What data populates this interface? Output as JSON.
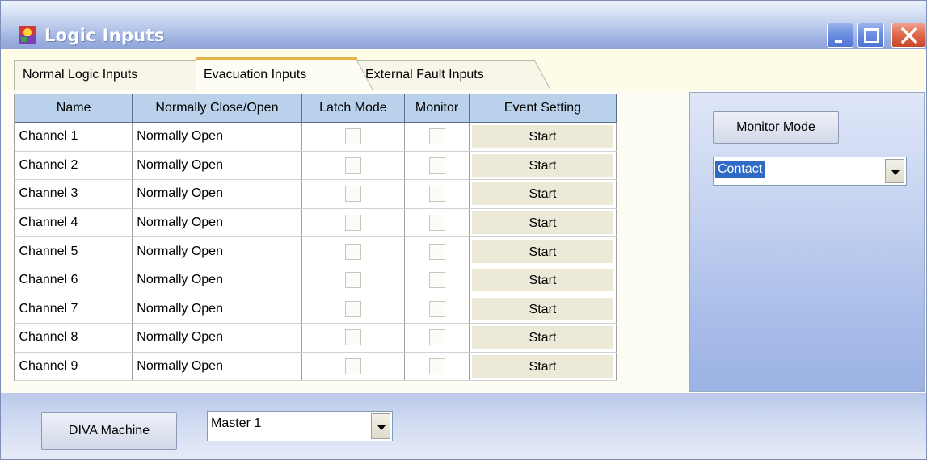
{
  "window": {
    "title": "Logic Inputs",
    "controls": [
      "minimize-icon",
      "maximize-icon",
      "close-icon"
    ]
  },
  "tabs": [
    {
      "label": "Normal Logic Inputs"
    },
    {
      "label": "Evacuation Inputs",
      "selected": true
    },
    {
      "label": "External Fault Inputs"
    }
  ],
  "grid": {
    "columns": [
      "Name",
      "Normally Close/Open",
      "Latch Mode",
      "Monitor",
      "Event Setting"
    ],
    "rows": [
      {
        "name": "Channel 1",
        "mode": "Normally Open",
        "latch": false,
        "monitor": false,
        "event": "Start"
      },
      {
        "name": "Channel 2",
        "mode": "Normally Open",
        "latch": false,
        "monitor": false,
        "event": "Start"
      },
      {
        "name": "Channel 3",
        "mode": "Normally Open",
        "latch": false,
        "monitor": false,
        "event": "Start"
      },
      {
        "name": "Channel 4",
        "mode": "Normally Open",
        "latch": false,
        "monitor": false,
        "event": "Start"
      },
      {
        "name": "Channel 5",
        "mode": "Normally Open",
        "latch": false,
        "monitor": false,
        "event": "Start"
      },
      {
        "name": "Channel 6",
        "mode": "Normally Open",
        "latch": false,
        "monitor": false,
        "event": "Start"
      },
      {
        "name": "Channel 7",
        "mode": "Normally Open",
        "latch": false,
        "monitor": false,
        "event": "Start"
      },
      {
        "name": "Channel 8",
        "mode": "Normally Open",
        "latch": false,
        "monitor": false,
        "event": "Start"
      },
      {
        "name": "Channel 9",
        "mode": "Normally Open",
        "latch": false,
        "monitor": false,
        "event": "Start"
      }
    ]
  },
  "right_panel": {
    "monitor_mode_label": "Monitor Mode",
    "mode_value": "Contact"
  },
  "bottom": {
    "diva_label": "DIVA Machine",
    "machine_value": "Master 1"
  },
  "colors": {
    "grid_header": "#b9d1ea",
    "selected_tab_accent": "#e5b44a",
    "selection": "#316ac5"
  }
}
